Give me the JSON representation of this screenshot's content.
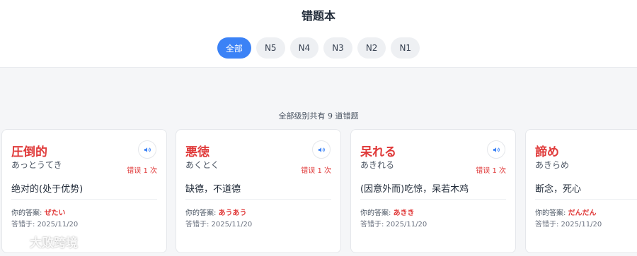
{
  "header": {
    "title": "错题本",
    "tabs": [
      {
        "label": "全部",
        "active": true
      },
      {
        "label": "N5",
        "active": false
      },
      {
        "label": "N4",
        "active": false
      },
      {
        "label": "N3",
        "active": false
      },
      {
        "label": "N2",
        "active": false
      },
      {
        "label": "N1",
        "active": false
      }
    ]
  },
  "summary": "全部级别共有 9 道错题",
  "cards": [
    {
      "word": "圧倒的",
      "reading": "あっとうてき",
      "error_count": "错误 1 次",
      "meaning": "绝对的(处于优势)",
      "answer_label": "你的答案:",
      "answer_value": "ぜたい",
      "date": "答错于: 2025/11/20"
    },
    {
      "word": "悪徳",
      "reading": "あくとく",
      "error_count": "错误 1 次",
      "meaning": "缺德，不道德",
      "answer_label": "你的答案:",
      "answer_value": "あうあう",
      "date": "答错于: 2025/11/20"
    },
    {
      "word": "呆れる",
      "reading": "あきれる",
      "error_count": "错误 1 次",
      "meaning": "(因意外而)吃惊，呆若木鸡",
      "answer_label": "你的答案:",
      "answer_value": "あきき",
      "date": "答错于: 2025/11/20"
    },
    {
      "word": "諦め",
      "reading": "あきらめ",
      "error_count": "",
      "meaning": "断念，死心",
      "answer_label": "你的答案:",
      "answer_value": "だんだん",
      "date": "答错于: 2025/11/20"
    }
  ],
  "watermark": "大败跨境",
  "colors": {
    "accent": "#3b82f6",
    "error": "#e03a3a"
  },
  "icons": {
    "speaker": "speaker-icon"
  }
}
